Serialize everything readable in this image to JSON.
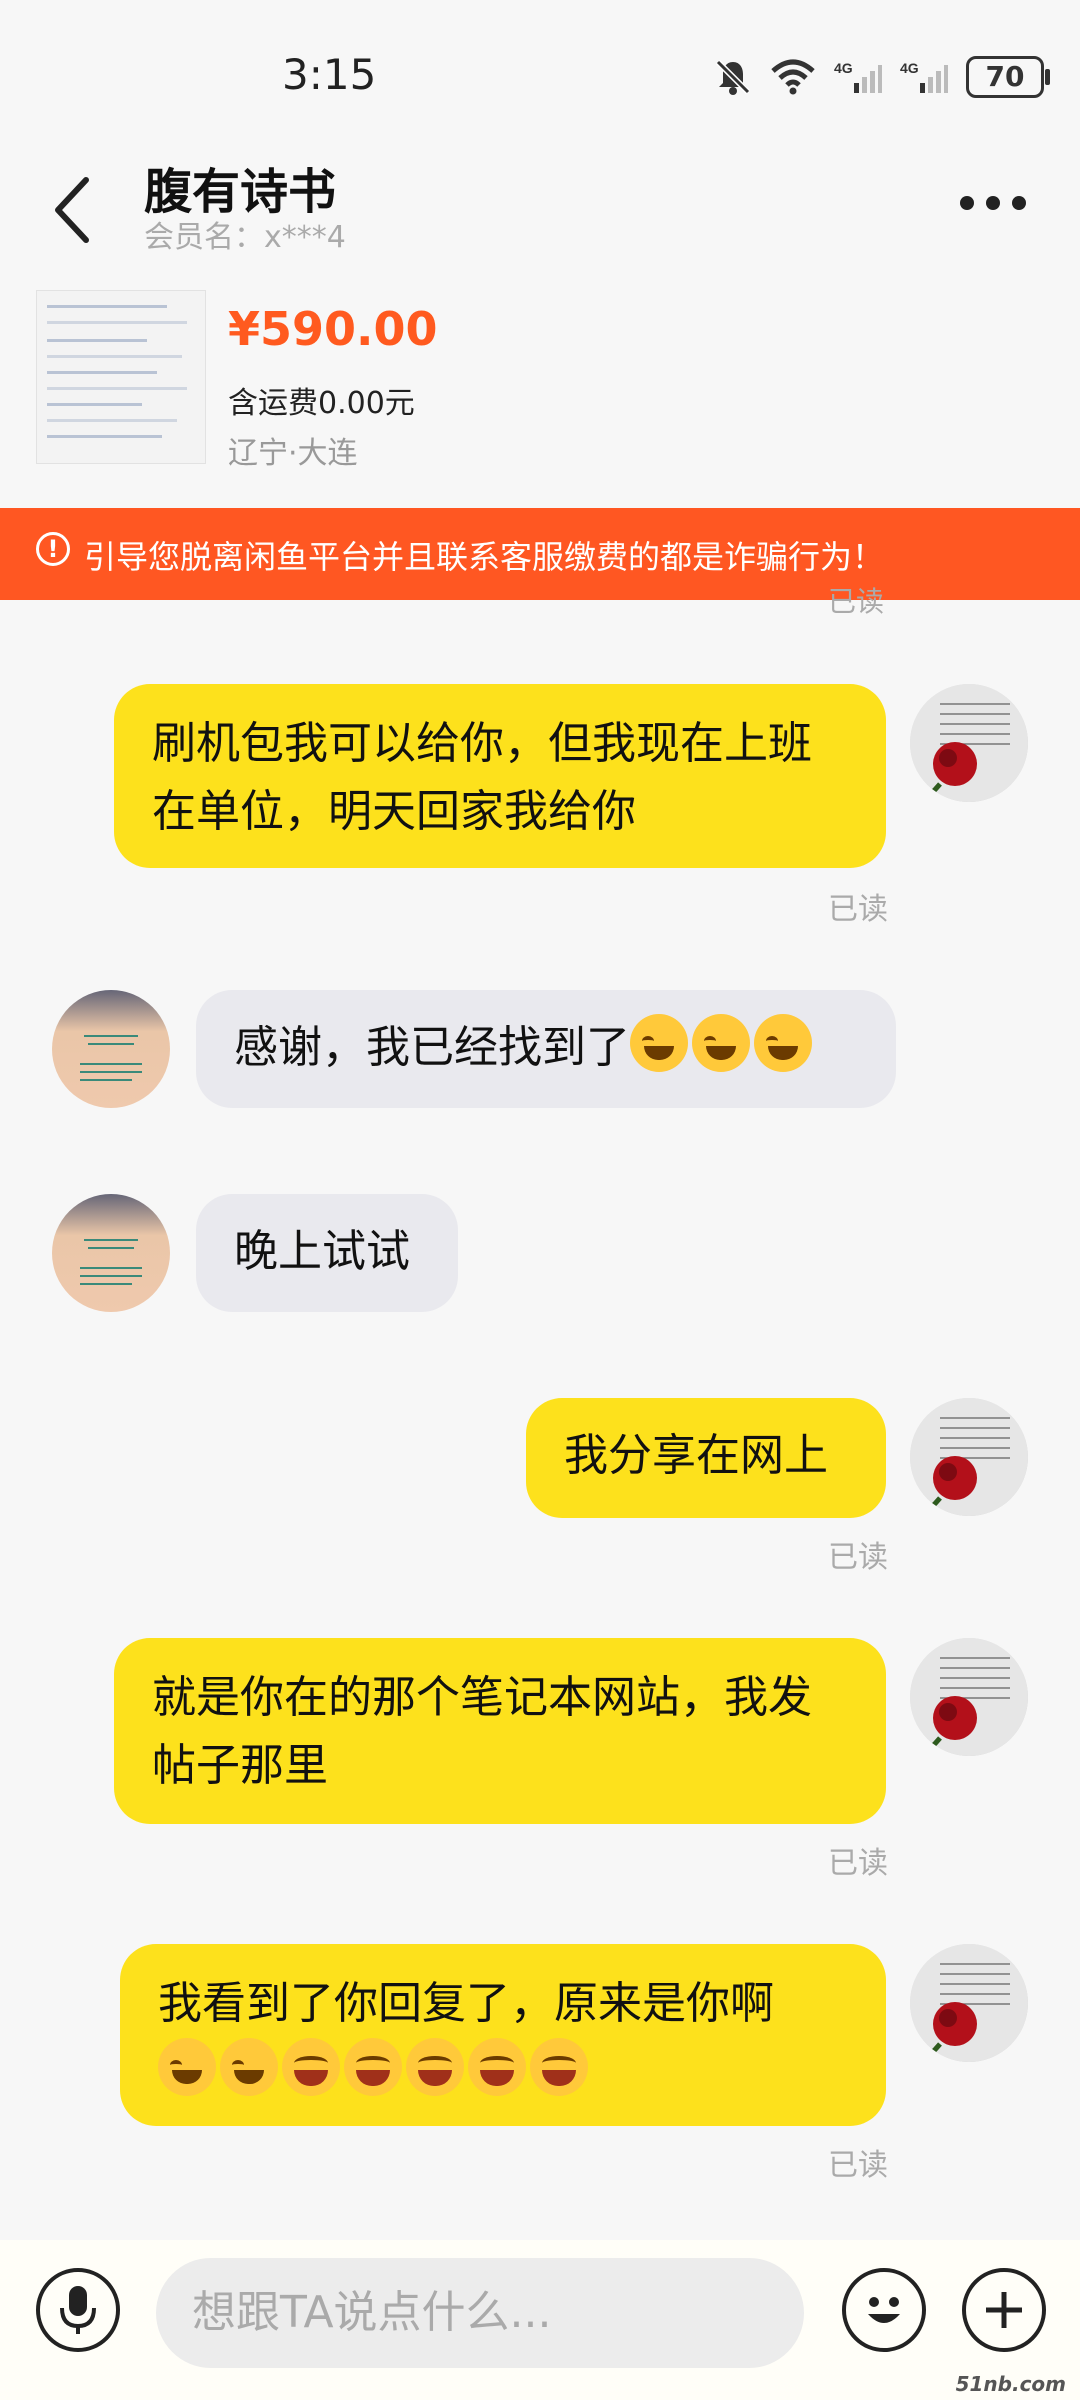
{
  "status": {
    "time": "3:15",
    "battery": "70",
    "network_1": "4G",
    "network_2": "4G"
  },
  "header": {
    "title": "腹有诗书",
    "subtitle": "会员名：x***4"
  },
  "product": {
    "price": "¥590.00",
    "shipping": "含运费0.00元",
    "location": "辽宁·大连"
  },
  "warning": {
    "text": "引导您脱离闲鱼平台并且联系客服缴费的都是诈骗行为！",
    "icon": "!"
  },
  "read_label": "已读",
  "messages": [
    {
      "side": "me",
      "text": "刷机包我可以给你，但我现在上班在单位，明天回家我给你",
      "read": "已读"
    },
    {
      "side": "them",
      "text": "感谢，我已经找到了",
      "emojis": [
        "cry",
        "cry",
        "cry"
      ]
    },
    {
      "side": "them",
      "text": "晚上试试"
    },
    {
      "side": "me",
      "text": "我分享在网上",
      "read": "已读"
    },
    {
      "side": "me",
      "text": "就是你在的那个笔记本网站，我发帖子那里",
      "read": "已读"
    },
    {
      "side": "me",
      "text": "我看到了你回复了，原来是你啊",
      "emojis": [
        "cry",
        "cry",
        "grin",
        "grin",
        "grin",
        "grin",
        "grin"
      ],
      "read": "已读"
    }
  ],
  "input": {
    "placeholder": "想跟TA说点什么..."
  },
  "watermark": "51nb.com",
  "colors": {
    "accent": "#fde11c",
    "warning_bg": "#ff5722",
    "price": "#ff5a1f"
  }
}
